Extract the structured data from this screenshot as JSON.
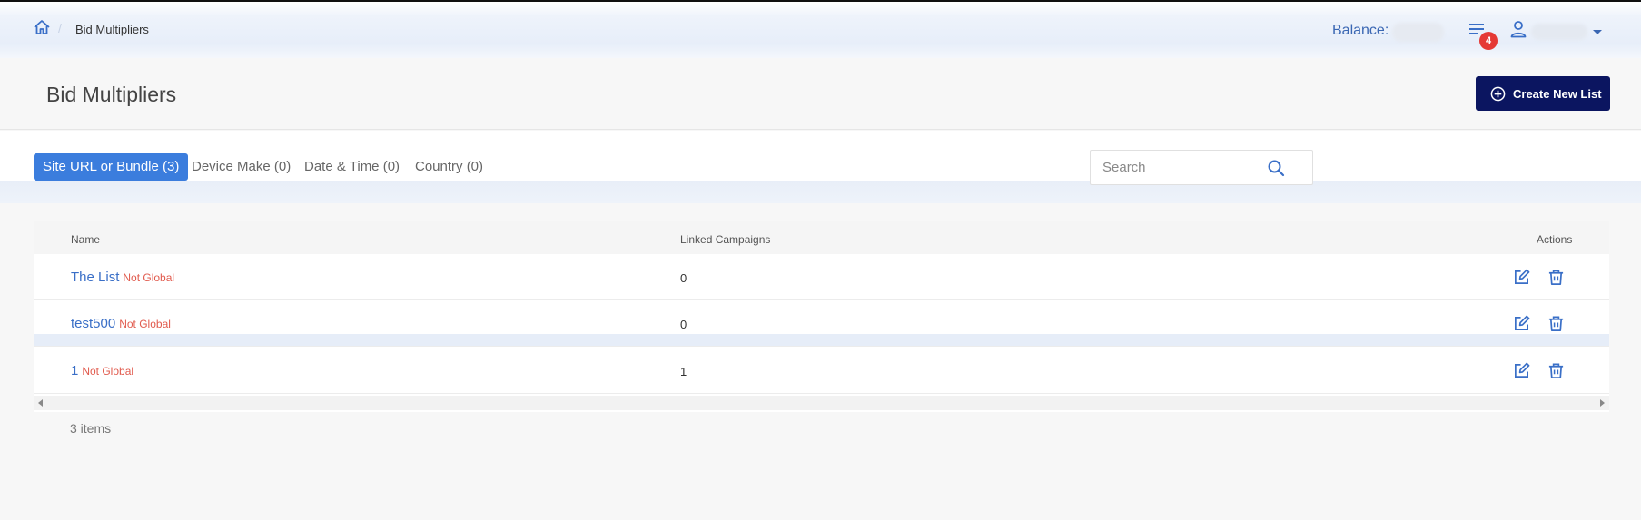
{
  "breadcrumb": {
    "current": "Bid Multipliers"
  },
  "header": {
    "balance_label": "Balance:",
    "notifications_count": "4"
  },
  "page": {
    "title": "Bid Multipliers",
    "create_button_label": "Create New List"
  },
  "tabs": [
    {
      "label": "Site URL or Bundle (3)",
      "active": true
    },
    {
      "label": "Device Make (0)",
      "active": false
    },
    {
      "label": "Date & Time (0)",
      "active": false
    },
    {
      "label": "Country (0)",
      "active": false
    }
  ],
  "search": {
    "placeholder": "Search",
    "value": ""
  },
  "table": {
    "columns": [
      "Name",
      "Linked Campaigns",
      "Actions"
    ],
    "rows": [
      {
        "name": "The List",
        "scope": "Not Global",
        "linked_campaigns": "0"
      },
      {
        "name": "test500",
        "scope": "Not Global",
        "linked_campaigns": "0"
      },
      {
        "name": "1",
        "scope": "Not Global",
        "linked_campaigns": "1"
      }
    ],
    "items_count": "3 items"
  },
  "icons": {
    "home": "home-icon",
    "messages": "list-icon",
    "user": "user-icon",
    "create": "plus-circle-icon",
    "search": "search-icon",
    "edit": "edit-icon",
    "delete": "trash-icon"
  },
  "colors": {
    "primary_button": "#0b1560",
    "active_tab": "#3b7ddd",
    "link": "#3a6fc7",
    "not_global": "#e15b4e",
    "badge": "#e53935"
  }
}
